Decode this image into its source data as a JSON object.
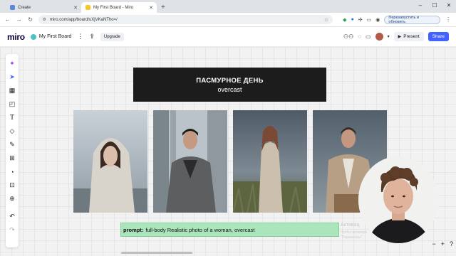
{
  "browser": {
    "tabs": [
      {
        "title": "Create",
        "favicon_color": "#5a86e0",
        "active": false
      },
      {
        "title": "My First Board - Miro",
        "favicon_color": "#f7c52b",
        "active": true
      }
    ],
    "new_tab": "+",
    "window_controls": [
      "–",
      "☐",
      "✕"
    ],
    "url": "miro.com/app/board/uXjVKaNTho=/",
    "restart_label": "Перезапустить и обновить"
  },
  "miro": {
    "logo": "miro",
    "board_name": "My First Board",
    "upgrade_label": "Upgrade",
    "present_label": "Present",
    "share_label": "Share",
    "toolbar_icons": [
      "sparkle-icon",
      "cursor-icon",
      "template-icon",
      "sticky-note-icon",
      "text-icon",
      "shapes-icon",
      "pen-icon",
      "frame-icon",
      "comment-icon",
      "upload-icon",
      "plus-icon",
      "undo-icon",
      "redo-icon"
    ]
  },
  "board": {
    "banner_title": "ПАСМУРНОЕ ДЕНЬ",
    "banner_subtitle": "overcast",
    "prompt_label": "prompt:",
    "prompt_text": "full-body Realistic photo of a woman, overcast",
    "activation_title": "Активац",
    "activation_line1": "Чтобы активиро",
    "activation_line2": "\"Параметры\"."
  },
  "colors": {
    "accent": "#4262ff",
    "banner_bg": "#1c1c1c",
    "prompt_bg": "#abe5bb"
  }
}
